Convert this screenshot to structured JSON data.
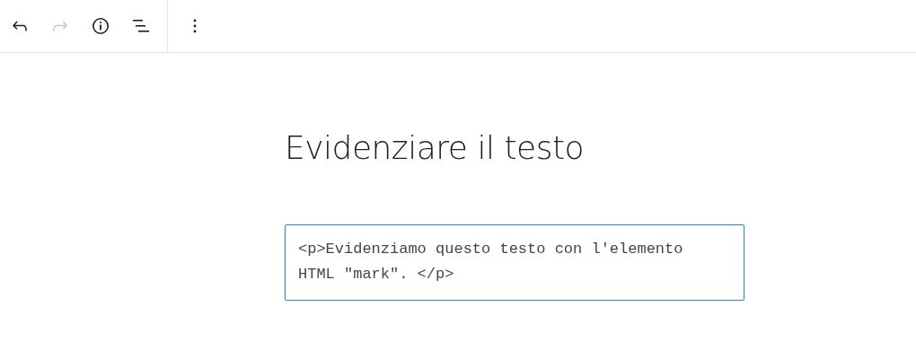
{
  "toolbar": {
    "buttons": [
      {
        "kind": "undo",
        "disabled": false
      },
      {
        "kind": "redo",
        "disabled": true
      },
      {
        "kind": "info",
        "disabled": false
      },
      {
        "kind": "list",
        "disabled": false
      }
    ],
    "menu": {
      "kind": "more"
    }
  },
  "post_title": "Evidenziare il testo",
  "html_block": {
    "content": "<p>Evidenziamo questo testo con l'elemento HTML \"mark\". </p>"
  }
}
